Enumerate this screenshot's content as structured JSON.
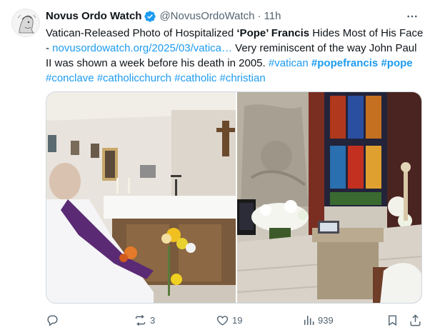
{
  "author": {
    "name": "Novus Ordo Watch",
    "handle": "@NovusOrdoWatch",
    "separator": "·",
    "time": "11h",
    "verified_icon": "verified-badge-icon"
  },
  "tweet": {
    "t1": "Vatican-Released Photo of Hospitalized ",
    "t2": "‘Pope’ Francis",
    "t3": " Hides Most of His Face - ",
    "link": "novusordowatch.org/2025/03/vatica…",
    "t4": " Very reminiscent of the way John Paul II was shown a week before his death in 2005. ",
    "tags": [
      "#vatican",
      "#popefrancis",
      "#pope",
      "#conclave",
      "#catholicchurch",
      "#catholic",
      "#christian"
    ]
  },
  "actions": {
    "reply": "",
    "retweet": "3",
    "like": "19",
    "views": "939"
  },
  "colors": {
    "accent": "#1d9bf0",
    "muted": "#536471",
    "text": "#0f1419"
  }
}
